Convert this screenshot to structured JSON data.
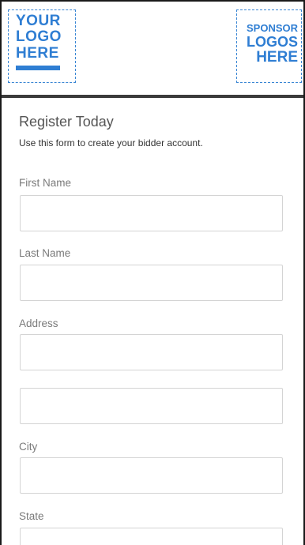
{
  "header": {
    "logo_lines": [
      "YOUR",
      "LOGO",
      "HERE"
    ],
    "sponsor_lines": [
      "SPONSOR",
      "LOGOS",
      "HERE"
    ],
    "accent_color": "#2f7ed3"
  },
  "form": {
    "title": "Register Today",
    "subtitle": "Use this form to create your bidder account.",
    "fields": {
      "first_name": {
        "label": "First Name",
        "value": ""
      },
      "last_name": {
        "label": "Last Name",
        "value": ""
      },
      "address": {
        "label": "Address",
        "value": ""
      },
      "address2": {
        "value": ""
      },
      "city": {
        "label": "City",
        "value": ""
      },
      "state": {
        "label": "State",
        "value": ""
      }
    }
  }
}
